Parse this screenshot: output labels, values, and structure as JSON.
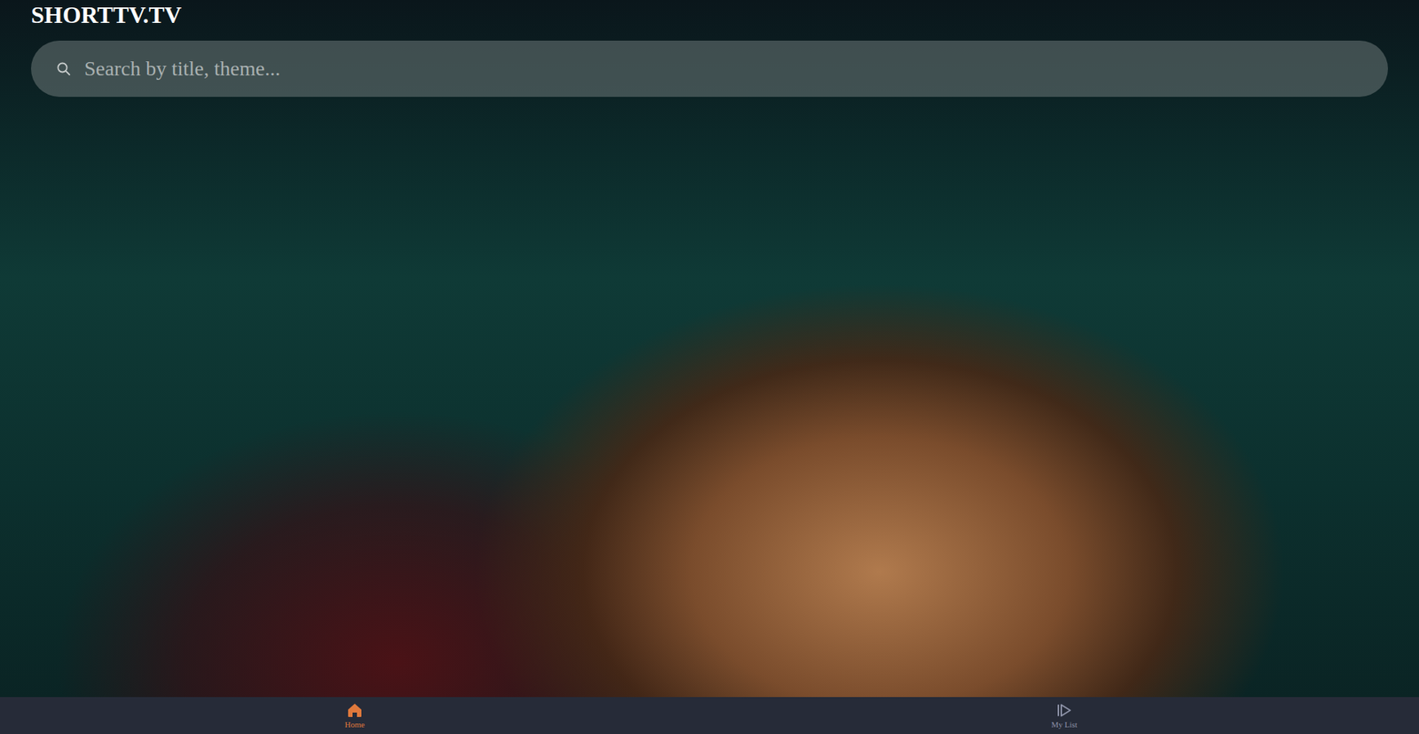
{
  "logo": "SHORTTV.TV",
  "search": {
    "placeholder": "Search by title, theme..."
  },
  "nav": [
    {
      "label": "Home",
      "selected": true
    },
    {
      "label": "My List",
      "selected": false
    }
  ]
}
